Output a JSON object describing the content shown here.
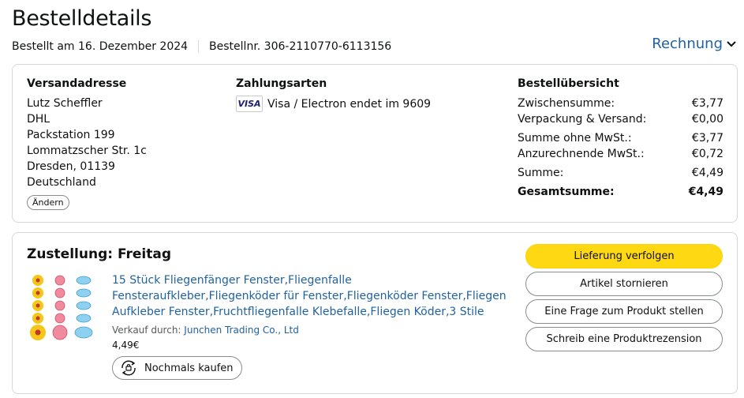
{
  "page": {
    "title": "Bestelldetails"
  },
  "meta": {
    "ordered_date": "Bestellt am 16. Dezember 2024",
    "order_number": "Bestellnr. 306-2110770-6113156",
    "invoice_label": "Rechnung"
  },
  "shipping": {
    "title": "Versandadresse",
    "lines": [
      "Lutz Scheffler",
      "DHL",
      "Packstation 199",
      "Lommatzscher Str. 1c",
      "Dresden, 01139",
      "Deutschland"
    ],
    "change_label": "Ändern"
  },
  "payment": {
    "title": "Zahlungsarten",
    "card_brand": "VISA",
    "card_text": "Visa / Electron endet im 9609"
  },
  "summary": {
    "title": "Bestellübersicht",
    "rows": [
      {
        "label": "Zwischensumme:",
        "value": "€3,77"
      },
      {
        "label": "Verpackung & Versand:",
        "value": "€0,00"
      },
      {
        "label": "Summe ohne MwSt.:",
        "value": "€3,77"
      },
      {
        "label": "Anzurechnende MwSt.:",
        "value": "€0,72"
      },
      {
        "label": "Summe:",
        "value": "€4,49"
      },
      {
        "label": "Gesamtsumme:",
        "value": "€4,49"
      }
    ]
  },
  "delivery": {
    "title": "Zustellung: Freitag",
    "product": {
      "title": "15 Stück Fliegenfänger Fenster,Fliegenfalle Fensteraufkleber,Fliegenköder für Fenster,Fliegenköder Fenster,Fliegen Aufkleber Fenster,Fruchtfliegenfalle Klebefalle,Fliegen Köder,3 Stile",
      "seller_prefix": "Verkauf durch:",
      "seller_name": "Junchen Trading Co., Ltd",
      "price": "4,49€",
      "rebuy_label": "Nochmals kaufen"
    },
    "actions": {
      "track": "Lieferung verfolgen",
      "cancel": "Artikel stornieren",
      "question": "Eine Frage zum Produkt stellen",
      "review": "Schreib eine Produktrezension"
    }
  },
  "colors": {
    "accent_link": "#2162a1",
    "primary_button": "#ffd814",
    "border": "#d5d9d9"
  }
}
